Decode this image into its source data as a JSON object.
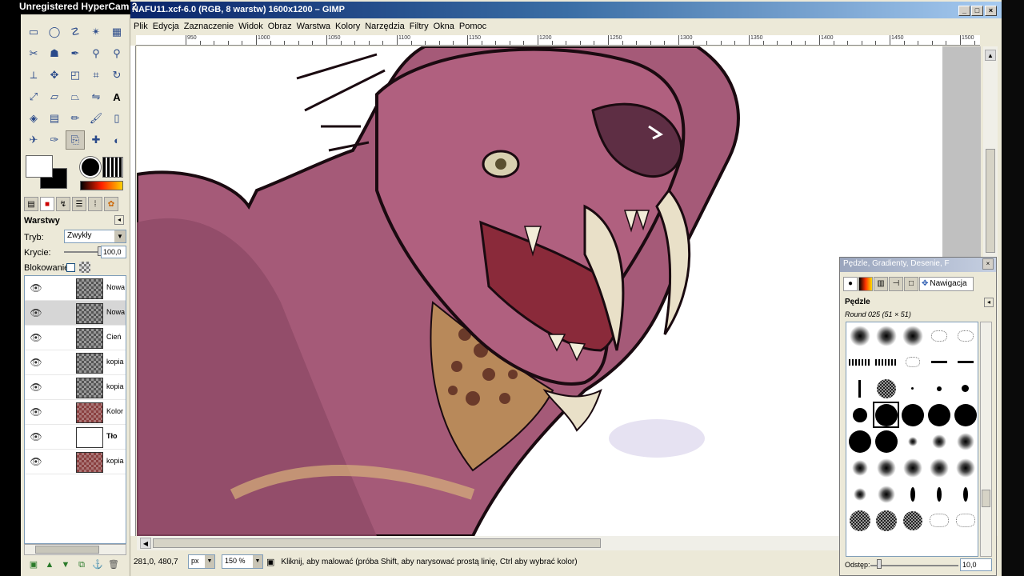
{
  "watermark": "Unregistered HyperCam 2",
  "window": {
    "title": "NAFU11.xcf-6.0 (RGB, 8 warstw) 1600x1200 – GIMP",
    "menu": [
      "Plik",
      "Edycja",
      "Zaznaczenie",
      "Widok",
      "Obraz",
      "Warstwa",
      "Kolory",
      "Narzędzia",
      "Filtry",
      "Okna",
      "Pomoc"
    ],
    "ruler_labels": [
      "950",
      "1000",
      "1050",
      "1100",
      "1150",
      "1200",
      "1250",
      "1300",
      "1350",
      "1400",
      "1450",
      "1500"
    ]
  },
  "toolbox": {
    "tools": [
      "rect-select",
      "ellipse-select",
      "lasso",
      "fuzzy-select",
      "select-by-color",
      "scissors",
      "foreground-select",
      "paths",
      "color-picker",
      "zoom",
      "measure",
      "move",
      "align",
      "crop",
      "rotate",
      "scale",
      "shear",
      "perspective",
      "flip",
      "text",
      "bucket-fill",
      "blend",
      "pencil",
      "paintbrush",
      "eraser",
      "airbrush",
      "ink",
      "clone",
      "heal",
      "dodge-burn"
    ],
    "active_tool_index": 27
  },
  "layers_panel": {
    "title": "Warstwy",
    "mode_label": "Tryb:",
    "mode_value": "Zwykły",
    "opacity_label": "Krycie:",
    "opacity_value": "100,0",
    "lock_label": "Blokowanie:",
    "layers": [
      {
        "name": "Nowa",
        "thumb": "checker",
        "bold": false,
        "selected": false
      },
      {
        "name": "Nowa",
        "thumb": "checker",
        "bold": false,
        "selected": true
      },
      {
        "name": "Cień",
        "thumb": "checker",
        "bold": false,
        "selected": false
      },
      {
        "name": "kopia",
        "thumb": "checker",
        "bold": false,
        "selected": false
      },
      {
        "name": "kopia",
        "thumb": "checker",
        "bold": false,
        "selected": false
      },
      {
        "name": "Kolor",
        "thumb": "red",
        "bold": false,
        "selected": false
      },
      {
        "name": "Tło",
        "thumb": "white",
        "bold": true,
        "selected": false
      },
      {
        "name": "kopia",
        "thumb": "red",
        "bold": false,
        "selected": false
      }
    ]
  },
  "statusbar": {
    "coords": "281,0, 480,7",
    "unit": "px",
    "zoom": "150 %",
    "message": "Kliknij, aby malować (próba Shift, aby narysować prostą linię, Ctrl aby wybrać kolor)"
  },
  "brushes_dock": {
    "title": "Pędzle, Gradienty, Desenie, F",
    "nav_tab": "Nawigacja",
    "heading": "Pędzle",
    "brush_name": "Round 025 (51 × 51)",
    "spacing_label": "Odstęp:",
    "spacing_value": "10,0"
  },
  "colors": {
    "titlebar": "#0a246a",
    "panel_bg": "#ece9d8",
    "creature_skin": "#a55a78",
    "creature_dark": "#5e2e44",
    "tusk": "#e9e0c8"
  }
}
